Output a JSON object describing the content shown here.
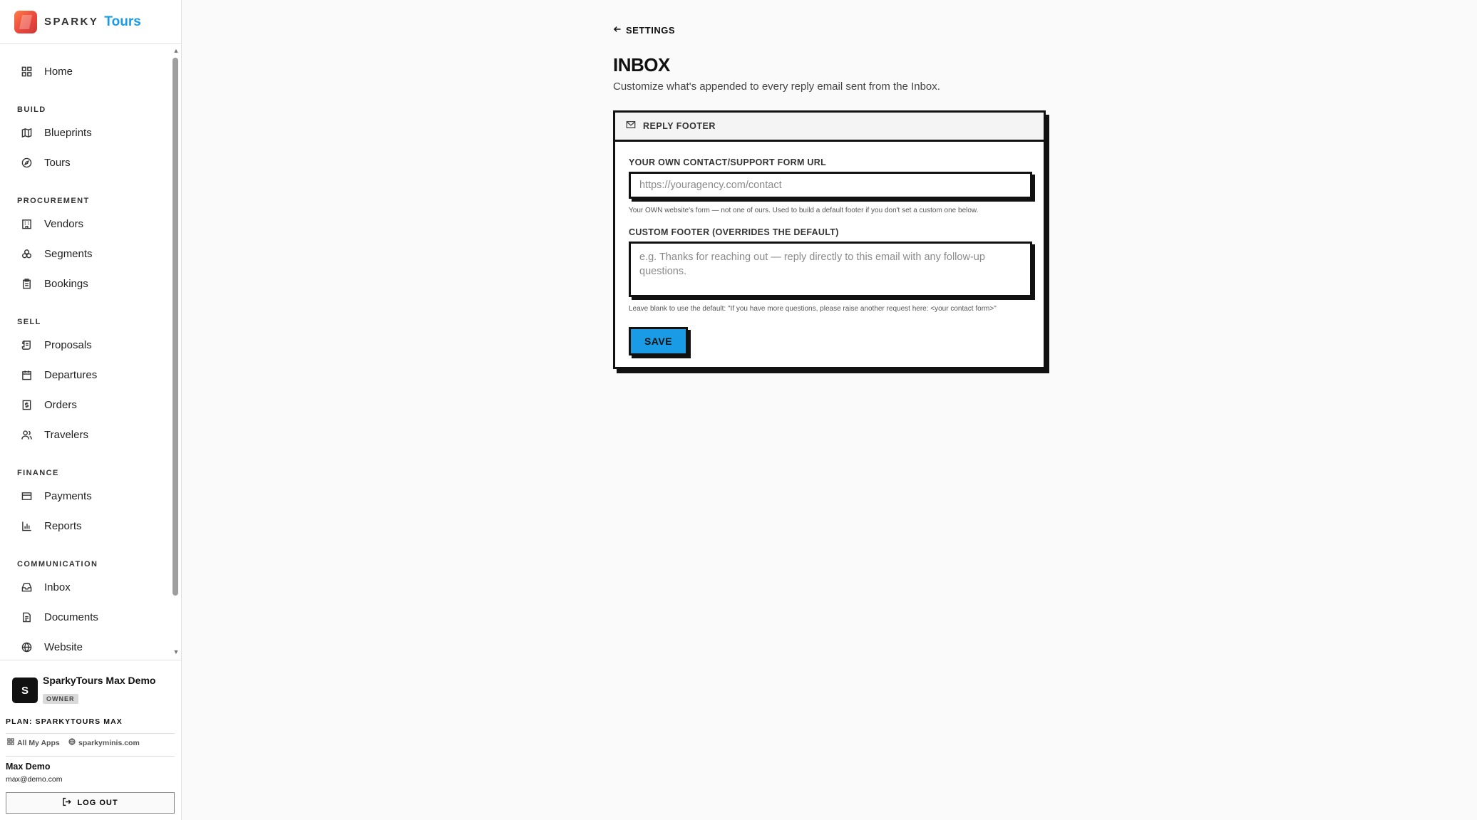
{
  "brand": {
    "sparky": "SPARKY",
    "tours": "Tours"
  },
  "nav": {
    "home": "Home",
    "sections": {
      "build": "BUILD",
      "procurement": "PROCUREMENT",
      "sell": "SELL",
      "finance": "FINANCE",
      "communication": "COMMUNICATION"
    },
    "items": {
      "blueprints": "Blueprints",
      "tours": "Tours",
      "vendors": "Vendors",
      "segments": "Segments",
      "bookings": "Bookings",
      "proposals": "Proposals",
      "departures": "Departures",
      "orders": "Orders",
      "travelers": "Travelers",
      "payments": "Payments",
      "reports": "Reports",
      "inbox": "Inbox",
      "documents": "Documents",
      "website": "Website"
    }
  },
  "account": {
    "avatar_letter": "S",
    "org_name": "SparkyTours Max Demo",
    "role": "OWNER",
    "plan": "PLAN: SPARKYTOURS MAX",
    "all_apps": "All My Apps",
    "site": "sparkyminis.com",
    "user_name": "Max Demo",
    "user_email": "max@demo.com",
    "logout": "LOG OUT"
  },
  "page": {
    "back": "SETTINGS",
    "title": "INBOX",
    "subtitle": "Customize what's appended to every reply email sent from the Inbox."
  },
  "card": {
    "title": "REPLY FOOTER",
    "url_label": "YOUR OWN CONTACT/SUPPORT FORM URL",
    "url_value": "",
    "url_placeholder": "https://youragency.com/contact",
    "url_help": "Your OWN website's form — not one of ours. Used to build a default footer if you don't set a custom one below.",
    "footer_label": "CUSTOM FOOTER (OVERRIDES THE DEFAULT)",
    "footer_value": "",
    "footer_placeholder": "e.g. Thanks for reaching out — reply directly to this email with any follow-up questions.",
    "footer_help": "Leave blank to use the default: \"If you have more questions, please raise another request here: <your contact form>\"",
    "save": "SAVE"
  },
  "colors": {
    "accent": "#1a9be6",
    "ink": "#111111",
    "background": "#fafafa"
  }
}
